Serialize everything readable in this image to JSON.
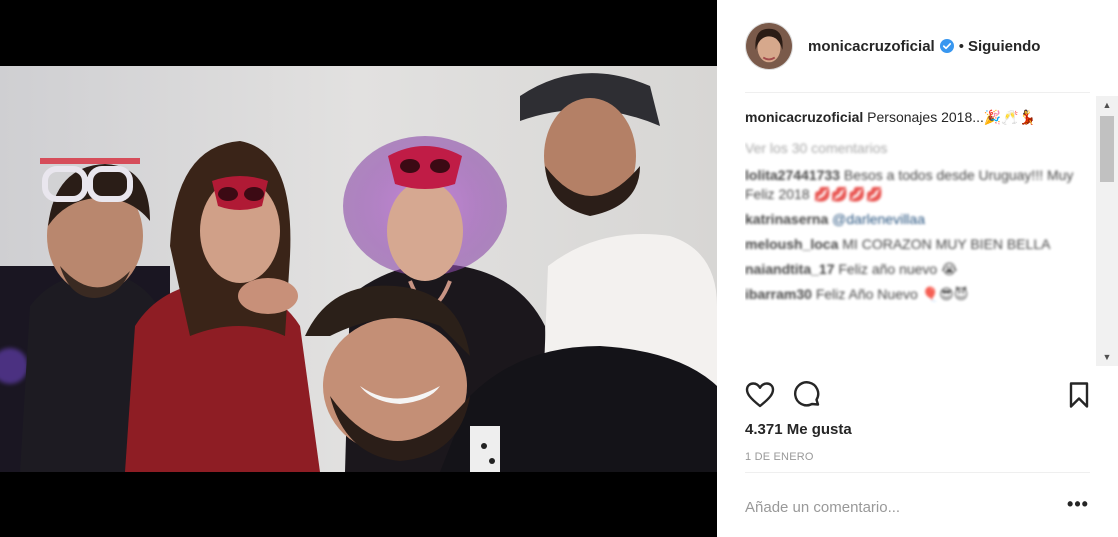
{
  "header": {
    "username": "monicacruzoficial",
    "separator": "•",
    "follow_status": "Siguiendo",
    "verified": true
  },
  "caption": {
    "username": "monicacruzoficial",
    "text": "Personajes 2018...🎉🥂💃"
  },
  "view_all_comments": "Ver los 30 comentarios",
  "comments": [
    {
      "username": "lolita27441733",
      "text": "Besos a todos desde Uruguay!!! Muy Feliz 2018 💋💋💋💋"
    },
    {
      "username": "katrinaserna",
      "text": "@darlenevillaa"
    },
    {
      "username": "meloush_loca",
      "text": "MI CORAZON MUY BIEN BELLA"
    },
    {
      "username": "naiandtita_17",
      "text": "Feliz año nuevo 😭"
    },
    {
      "username": "ibarram30",
      "text": "Feliz Año Nuevo 🎈😎😈"
    }
  ],
  "likes": "4.371 Me gusta",
  "date": "1 DE ENERO",
  "add_comment_placeholder": "Añade un comentario...",
  "more_options": "•••",
  "icons": {
    "like": "heart-icon",
    "comment": "comment-icon",
    "save": "bookmark-icon",
    "verified": "verified-badge-icon",
    "more": "more-options-icon"
  },
  "colors": {
    "verified_blue": "#3897f0",
    "text": "#262626",
    "muted": "#999999",
    "border": "#efefef"
  }
}
